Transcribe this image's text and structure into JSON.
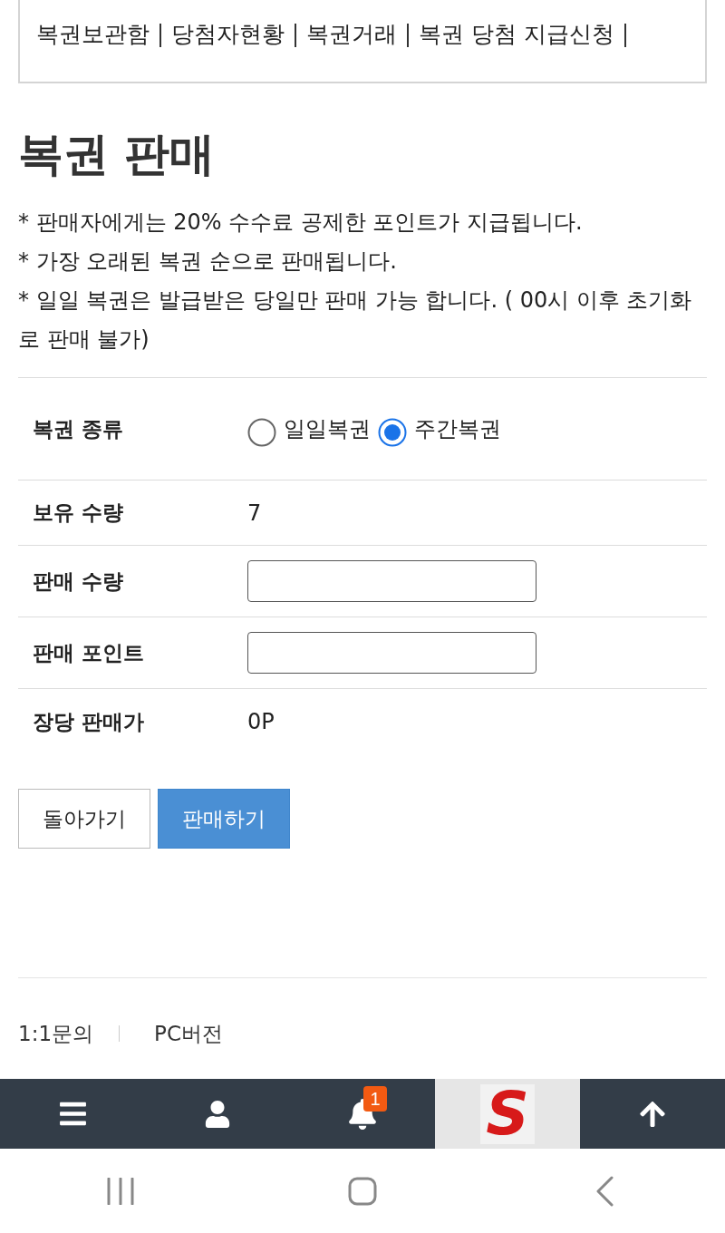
{
  "top_menu": {
    "items": [
      "복권보관함",
      "당첨자현황",
      "복권거래",
      "복권 당첨 지급신청"
    ]
  },
  "title": "복권 판매",
  "notes": [
    "* 판매자에게는 20% 수수료 공제한 포인트가 지급됩니다.",
    "* 가장 오래된 복권 순으로 판매됩니다.",
    "* 일일 복권은 발급받은 당일만 판매 가능 합니다. ( 00시 이후 초기화로 판매 불가)"
  ],
  "form": {
    "rows": [
      {
        "kind": "radio",
        "label": "복권 종류",
        "options": [
          {
            "label": "일일복권",
            "selected": false
          },
          {
            "label": "주간복권",
            "selected": true
          }
        ]
      },
      {
        "kind": "value",
        "label": "보유 수량",
        "value": "7"
      },
      {
        "kind": "input",
        "label": "판매 수량"
      },
      {
        "kind": "input",
        "label": "판매 포인트"
      },
      {
        "kind": "value",
        "label": "장당 판매가",
        "value": "0P"
      }
    ]
  },
  "buttons": [
    {
      "label": "돌아가기",
      "kind": "secondary"
    },
    {
      "label": "판매하기",
      "kind": "primary"
    }
  ],
  "footer_links": [
    "1:1문의",
    "PC버전"
  ],
  "bottom_nav": {
    "items": [
      {
        "kind": "menu"
      },
      {
        "kind": "user"
      },
      {
        "kind": "bell",
        "badge": "1"
      },
      {
        "kind": "logo",
        "text": "S"
      },
      {
        "kind": "up"
      }
    ]
  },
  "system_nav": {
    "items": [
      {
        "kind": "recents"
      },
      {
        "kind": "home"
      },
      {
        "kind": "back"
      }
    ]
  }
}
